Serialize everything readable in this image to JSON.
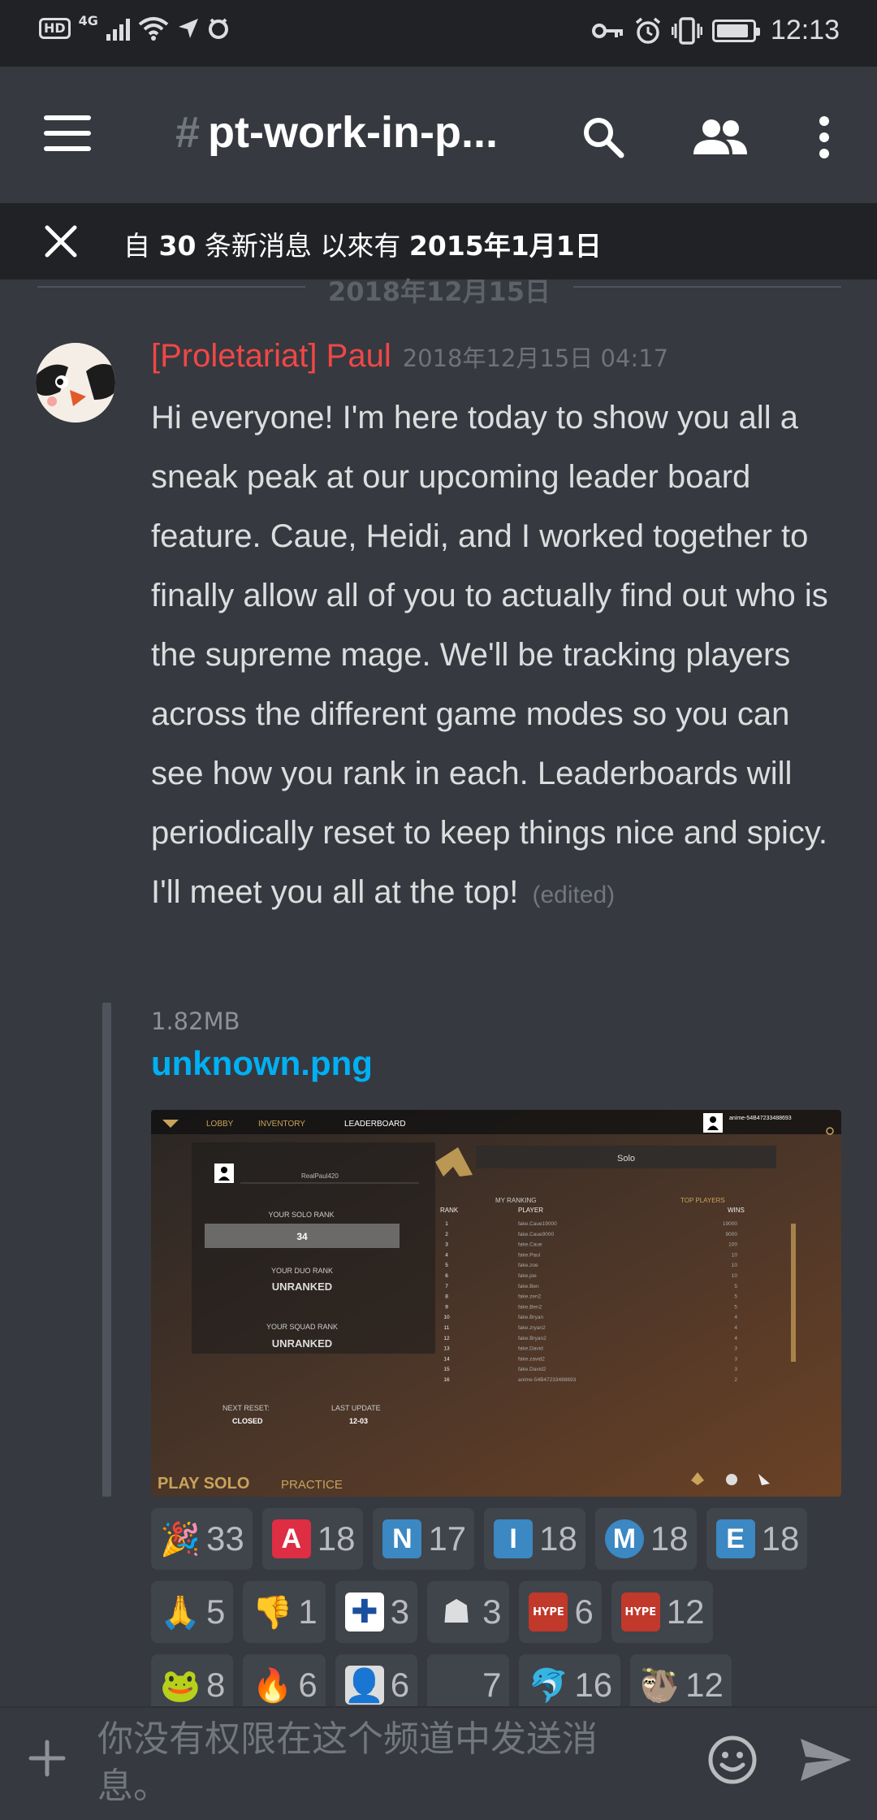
{
  "status_bar": {
    "time": "12:13",
    "hd": "HD",
    "network": "4G",
    "icons": [
      "hd-icon",
      "signal-icon",
      "wifi-icon",
      "location-icon",
      "alarm-shield-icon",
      "key-icon",
      "alarm-icon",
      "vibrate-icon",
      "battery-icon"
    ]
  },
  "header": {
    "channel_hash": "#",
    "channel_name": "pt-work-in-p...",
    "icons": [
      "menu-icon",
      "search-icon",
      "members-icon",
      "more-icon"
    ]
  },
  "new_messages_bar": {
    "prefix": "自 ",
    "count": "30",
    "middle": " 条新消息 以來有 ",
    "date": "2015年1月1日"
  },
  "date_divider": "2018年12月15日",
  "message": {
    "author": "[Proletariat] Paul",
    "timestamp": "2018年12月15日 04:17",
    "author_color": "#f04747",
    "text": "Hi everyone! I'm here today to show you all a sneak peak at our upcoming leader board feature. Caue, Heidi, and I worked together to finally allow all of you to actually find out who is the supreme mage. We'll be tracking players across the different game modes so you can see how you rank in each. Leaderboards will periodically reset to keep things nice and spicy. I'll meet you all at the top!",
    "edited": "(edited)",
    "attachment": {
      "size": "1.82MB",
      "filename": "unknown.png",
      "screenshot": {
        "nav": [
          "LOBBY",
          "INVENTORY",
          "LEADERBOARD"
        ],
        "player_id": "anime-54B47233488693",
        "player_name": "RealPaul420",
        "solo_rank_label": "YOUR SOLO RANK",
        "solo_rank": "34",
        "duo_rank_label": "YOUR DUO RANK",
        "duo_rank": "UNRANKED",
        "squad_rank_label": "YOUR SQUAD RANK",
        "squad_rank": "UNRANKED",
        "next_reset_label": "NEXT RESET:",
        "next_reset": "CLOSED",
        "last_update_label": "LAST UPDATE",
        "last_update": "12-03",
        "mode_tab": "Solo",
        "my_ranking": "MY RANKING",
        "top_players": "TOP PLAYERS",
        "col_rank": "RANK",
        "col_player": "PLAYER",
        "col_wins": "WINS",
        "rows": [
          {
            "rank": "1",
            "player": "fake.Caue19000",
            "wins": "19000"
          },
          {
            "rank": "2",
            "player": "fake.Caue9000",
            "wins": "9000"
          },
          {
            "rank": "3",
            "player": "fake.Caue",
            "wins": "100"
          },
          {
            "rank": "4",
            "player": "fake.Paul",
            "wins": "10"
          },
          {
            "rank": "5",
            "player": "fake.zoe",
            "wins": "10"
          },
          {
            "rank": "6",
            "player": "fake.joe",
            "wins": "10"
          },
          {
            "rank": "7",
            "player": "fake.Ben",
            "wins": "5"
          },
          {
            "rank": "8",
            "player": "fake.zen2",
            "wins": "5"
          },
          {
            "rank": "9",
            "player": "fake.Ben2",
            "wins": "5"
          },
          {
            "rank": "10",
            "player": "fake.Bryan",
            "wins": "4"
          },
          {
            "rank": "11",
            "player": "fake.zryan2",
            "wins": "4"
          },
          {
            "rank": "12",
            "player": "fake.Bryan2",
            "wins": "4"
          },
          {
            "rank": "13",
            "player": "fake.David",
            "wins": "3"
          },
          {
            "rank": "14",
            "player": "fake.zavid2",
            "wins": "3"
          },
          {
            "rank": "15",
            "player": "fake.David2",
            "wins": "3"
          },
          {
            "rank": "16",
            "player": "anime-54B47233488693",
            "wins": "2"
          }
        ],
        "play_label": "PLAY SOLO",
        "practice_label": "PRACTICE"
      }
    },
    "reactions": [
      [
        {
          "icon": "party-popper-icon",
          "glyph": "🎉",
          "bg": "",
          "count": "33"
        },
        {
          "icon": "letter-a-icon",
          "glyph": "A",
          "bg": "#dd2e44",
          "count": "18"
        },
        {
          "icon": "letter-n-icon",
          "glyph": "N",
          "bg": "#3b88c3",
          "count": "17"
        },
        {
          "icon": "letter-i-icon",
          "glyph": "I",
          "bg": "#3b88c3",
          "count": "18"
        },
        {
          "icon": "circled-m-icon",
          "glyph": "M",
          "bg": "#3b88c3",
          "count": "18"
        },
        {
          "icon": "letter-e-icon",
          "glyph": "E",
          "bg": "#3b88c3",
          "count": "18"
        }
      ],
      [
        {
          "icon": "folded-hands-icon",
          "glyph": "🙏",
          "bg": "",
          "count": "5"
        },
        {
          "icon": "thumbs-down-icon",
          "glyph": "👎",
          "bg": "",
          "count": "1"
        },
        {
          "icon": "finland-flag-icon",
          "glyph": "✚",
          "bg": "#ffffff",
          "count": "3"
        },
        {
          "icon": "hooded-mage-icon",
          "glyph": "☗",
          "bg": "",
          "count": "3"
        },
        {
          "icon": "hype-sloth-icon",
          "glyph": "HYPE",
          "bg": "#c0392b",
          "count": "6"
        },
        {
          "icon": "hype-sloth-icon",
          "glyph": "HYPE",
          "bg": "#c0392b",
          "count": "12"
        }
      ],
      [
        {
          "icon": "pepe-frog-icon",
          "glyph": "🐸",
          "bg": "",
          "count": "8"
        },
        {
          "icon": "green-fire-icon",
          "glyph": "🔥",
          "bg": "",
          "count": "6"
        },
        {
          "icon": "shadow-figure-icon",
          "glyph": "👤",
          "bg": "#dddddd",
          "count": "6"
        },
        {
          "icon": "blank-emoji-icon",
          "glyph": "",
          "bg": "",
          "count": "7"
        },
        {
          "icon": "dolphin-icon",
          "glyph": "🐬",
          "bg": "",
          "count": "16"
        },
        {
          "icon": "red-sloth-icon",
          "glyph": "🦥",
          "bg": "",
          "count": "12"
        }
      ]
    ]
  },
  "composer": {
    "placeholder": "你没有权限在这个频道中发送消息。",
    "icons": [
      "plus-icon",
      "emoji-icon",
      "send-icon"
    ]
  },
  "colors": {
    "background": "#36393f",
    "dark_bar": "#202225",
    "link": "#00b0f4",
    "author": "#f04747"
  }
}
